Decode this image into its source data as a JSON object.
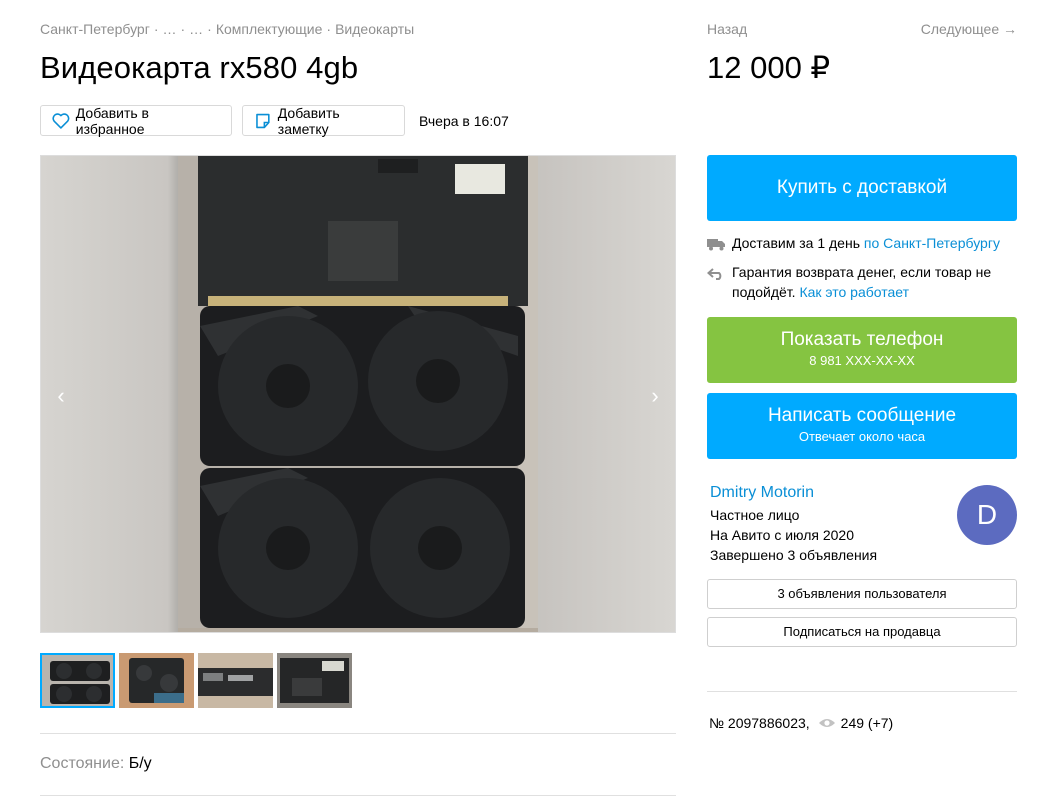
{
  "breadcrumbs": [
    "Санкт-Петербург",
    "…",
    "…",
    "Комплектующие",
    "Видеокарты"
  ],
  "title": "Видеокарта rx580 4gb",
  "actions": {
    "favorite_label": "Добавить в избранное",
    "note_label": "Добавить заметку",
    "date": "Вчера в 16:07"
  },
  "nav": {
    "back": "Назад",
    "next": "Следующее →"
  },
  "price": "12 000 ₽",
  "buy_button": "Купить с доставкой",
  "delivery": {
    "text": "Доставим за 1 день ",
    "link": "по Санкт-Петербургу"
  },
  "guarantee": {
    "text": "Гарантия возврата денег, если товар не подойдёт. ",
    "link": "Как это работает"
  },
  "phone_button": {
    "label": "Показать телефон",
    "number": "8 981 XXX-XX-XX"
  },
  "message_button": {
    "label": "Написать сообщение",
    "sub": "Отвечает около часа"
  },
  "seller": {
    "name": "Dmitry Motorin",
    "type": "Частное лицо",
    "since": "На Авито с июля 2020",
    "completed": "Завершено 3 объявления",
    "avatar_letter": "D",
    "avatar_color": "#5c6bc0"
  },
  "seller_ads_button": "3 объявления пользователя",
  "subscribe_button": "Подписаться на продавца",
  "meta": {
    "id": "№ 2097886023,",
    "views": "249 (+7)"
  },
  "condition": {
    "label": "Состояние:",
    "value": "Б/у"
  },
  "colors": {
    "accent_blue": "#00aaff",
    "phone_green": "#85c441",
    "link": "#0a8fd6"
  },
  "gallery": {
    "thumb_count": 4,
    "active_thumb": 1
  }
}
